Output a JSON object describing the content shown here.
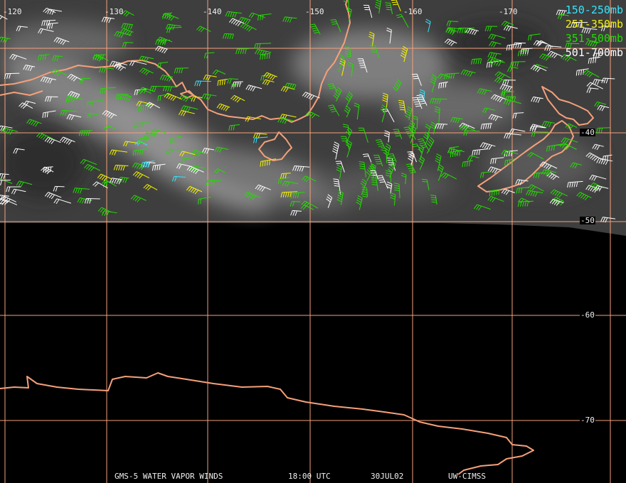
{
  "longitude_labels": [
    "-120",
    "-130",
    "-140",
    "-150",
    "-160",
    "-170"
  ],
  "latitude_labels": [
    "-40",
    "-50",
    "-60",
    "-70"
  ],
  "legend": [
    {
      "label": "150-250mb",
      "color": "#33e6ff"
    },
    {
      "label": "251-350mb",
      "color": "#f5f500"
    },
    {
      "label": "351-500mb",
      "color": "#22dd00"
    },
    {
      "label": "501-700mb",
      "color": "#ffffff"
    }
  ],
  "footer": {
    "product": "GMS-5 WATER VAPOR WINDS",
    "time": "18:00 UTC",
    "date": "30JUL02",
    "source": "UW-CIMSS"
  },
  "colors": {
    "coastline": "#f5a07a",
    "grid": "#f5a07a",
    "background": "#000000"
  }
}
